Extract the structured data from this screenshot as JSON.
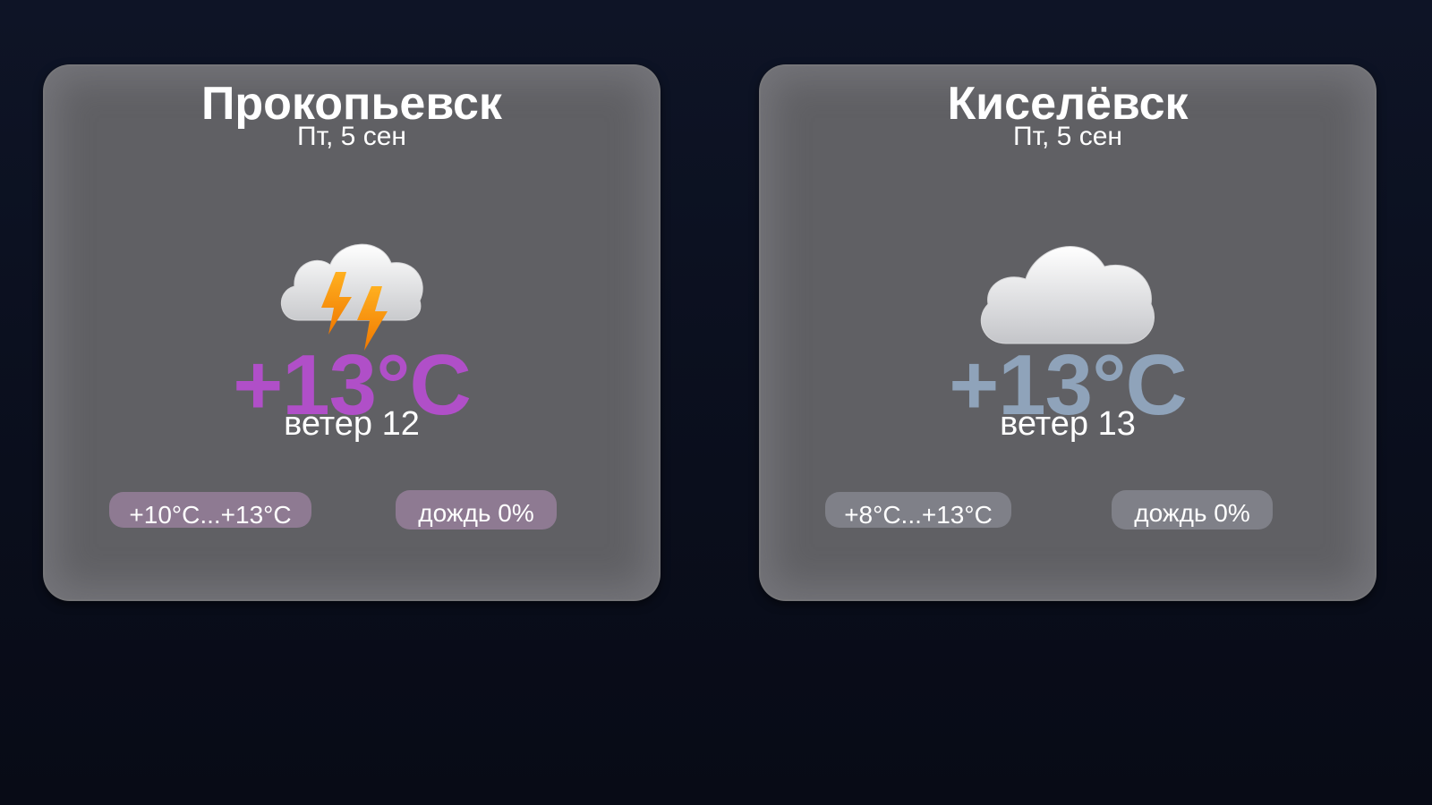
{
  "cards": [
    {
      "city": "Прокопьевск",
      "date": "Пт, 5 сен",
      "condition_icon": "thunderstorm-icon",
      "temperature": "+13°C",
      "temperature_color": "#b04fc8",
      "wind": "ветер 12",
      "range": "+10°C...+13°C",
      "rain": "дождь 0%"
    },
    {
      "city": "Киселёвск",
      "date": "Пт, 5 сен",
      "condition_icon": "cloud-icon",
      "temperature": "+13°C",
      "temperature_color": "#8fa3ba",
      "wind": "ветер 13",
      "range": "+8°C...+13°C",
      "rain": "дождь 0%"
    }
  ]
}
